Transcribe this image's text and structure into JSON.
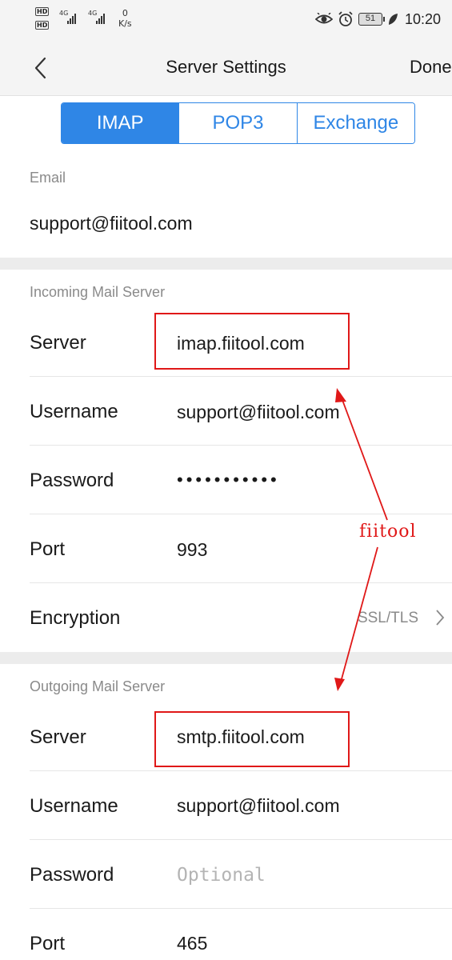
{
  "status_bar": {
    "hd_top": "HD",
    "hd_bottom": "HD",
    "net1": "4G",
    "net2": "4G",
    "speed_value": "0",
    "speed_unit": "K/s",
    "battery": "51",
    "time": "10:20"
  },
  "nav": {
    "title": "Server Settings",
    "done_label": "Done"
  },
  "tabs": [
    {
      "label": "IMAP",
      "active": true
    },
    {
      "label": "POP3",
      "active": false
    },
    {
      "label": "Exchange",
      "active": false
    }
  ],
  "email": {
    "label": "Email",
    "value": "support@fiitool.com"
  },
  "incoming": {
    "title": "Incoming Mail Server",
    "server_label": "Server",
    "server_value": "imap.fiitool.com",
    "username_label": "Username",
    "username_value": "support@fiitool.com",
    "password_label": "Password",
    "password_value": "•••••••••••",
    "port_label": "Port",
    "port_value": "993",
    "encryption_label": "Encryption",
    "encryption_value": "SSL/TLS"
  },
  "outgoing": {
    "title": "Outgoing Mail Server",
    "server_label": "Server",
    "server_value": "smtp.fiitool.com",
    "username_label": "Username",
    "username_value": "support@fiitool.com",
    "password_label": "Password",
    "password_placeholder": "Optional",
    "port_label": "Port",
    "port_value": "465"
  },
  "annotation": {
    "text": "fiitool",
    "color": "#e01818"
  },
  "colors": {
    "accent": "#2f86e6",
    "annotation": "#e01818"
  }
}
